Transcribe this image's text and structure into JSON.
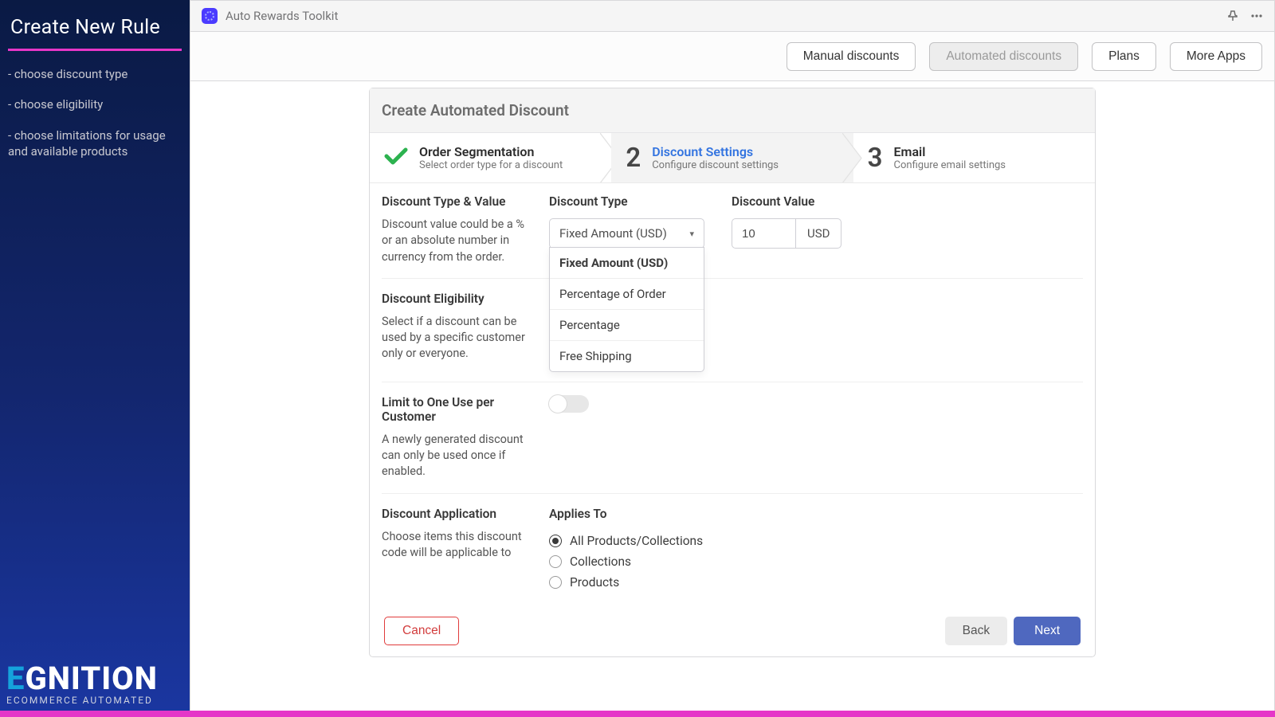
{
  "sidebar": {
    "title": "Create New Rule",
    "steps": [
      "- choose discount type",
      "- choose eligibility",
      "- choose limitations for usage and available products"
    ]
  },
  "brand": {
    "accent": "E",
    "rest": "GNITION",
    "sub": "ECOMMERCE AUTOMATED"
  },
  "header": {
    "title": "Auto Rewards Toolkit"
  },
  "toolbar": {
    "manual": "Manual discounts",
    "automated": "Automated discounts",
    "plans": "Plans",
    "more": "More Apps"
  },
  "card": {
    "title": "Create Automated Discount",
    "wizard": [
      {
        "title": "Order Segmentation",
        "sub": "Select order type for a discount"
      },
      {
        "title": "Discount Settings",
        "sub": "Configure discount settings"
      },
      {
        "title": "Email",
        "sub": "Configure email settings"
      }
    ]
  },
  "sections": {
    "typeValue": {
      "h": "Discount Type & Value",
      "p": "Discount value could be a % or an absolute number in currency from the order.",
      "typeLabel": "Discount Type",
      "selected": "Fixed Amount (USD)",
      "options": [
        "Fixed Amount (USD)",
        "Percentage of Order",
        "Percentage",
        "Free Shipping"
      ],
      "valueLabel": "Discount Value",
      "value": "10",
      "unit": "USD"
    },
    "eligibility": {
      "h": "Discount Eligibility",
      "p": "Select if a discount can be used by a specific customer only or everyone."
    },
    "limit": {
      "h": "Limit to One Use per Customer",
      "p": "A newly generated discount can only be used once if enabled."
    },
    "application": {
      "h": "Discount Application",
      "p": "Choose items this discount code will be applicable to",
      "appliesLabel": "Applies To",
      "options": [
        "All Products/Collections",
        "Collections",
        "Products"
      ],
      "selected": "All Products/Collections"
    }
  },
  "footer": {
    "cancel": "Cancel",
    "back": "Back",
    "next": "Next"
  }
}
